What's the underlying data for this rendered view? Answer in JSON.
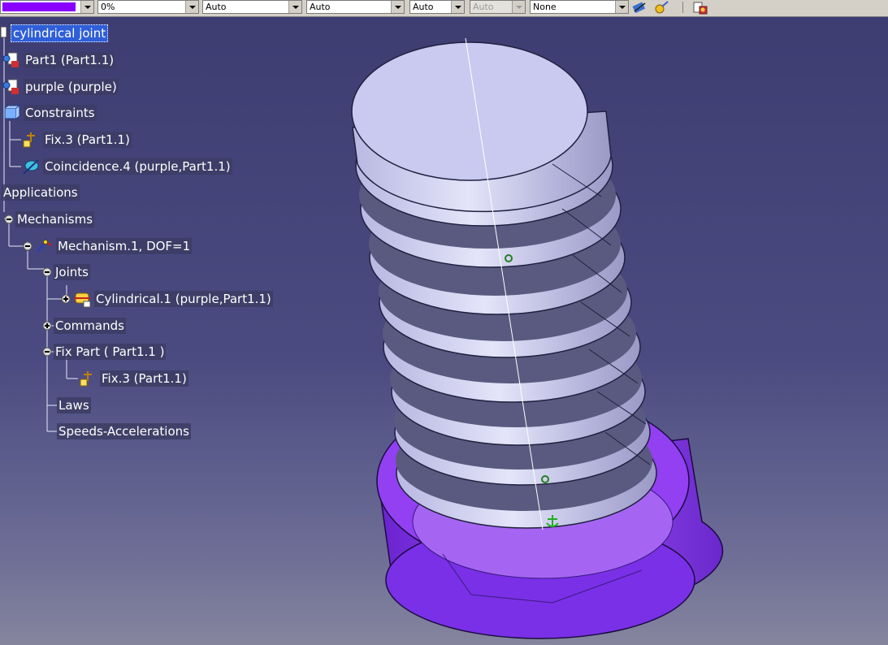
{
  "toolbar": {
    "color_swatch": "#8800ff",
    "transparency": "0%",
    "linetype": "Auto",
    "thickness": "Auto",
    "point_symbol": "Auto",
    "layer_auto": "Auto",
    "render_style": "None"
  },
  "tree": {
    "root": "cylindrical joint",
    "part1": "Part1 (Part1.1)",
    "purple": "purple (purple)",
    "constraints": "Constraints",
    "fix3": "Fix.3 (Part1.1)",
    "coincidence": "Coincidence.4 (purple,Part1.1)",
    "applications": "Applications",
    "mechanisms": "Mechanisms",
    "mechanism1": "Mechanism.1, DOF=1",
    "joints": "Joints",
    "cylindrical1": "Cylindrical.1 (purple,Part1.1)",
    "commands": "Commands",
    "fix_part": "Fix Part ( Part1.1 )",
    "fix3_b": "Fix.3 (Part1.1)",
    "laws": "Laws",
    "speeds": "Speeds-Accelerations"
  },
  "colors": {
    "background_top": "#3d3d72",
    "background_bottom": "#85859e",
    "screw_face": "#c9c9ee",
    "nut_purple": "#8a3cf0",
    "selection": "#2f5fd8"
  }
}
